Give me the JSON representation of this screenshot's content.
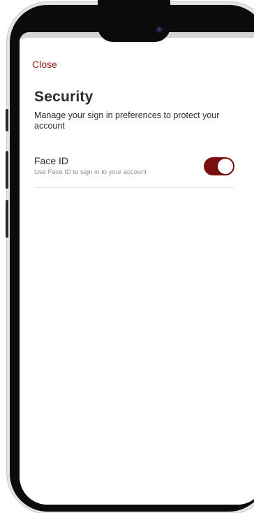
{
  "header": {
    "close_label": "Close"
  },
  "page": {
    "title": "Security",
    "subtitle": "Manage your sign in preferences to protect your account"
  },
  "settings": [
    {
      "title": "Face ID",
      "description": "Use Face ID to sign in to your account",
      "enabled": true
    }
  ],
  "colors": {
    "accent": "#8b1a1a",
    "toggle_on": "#7b0f0f"
  }
}
